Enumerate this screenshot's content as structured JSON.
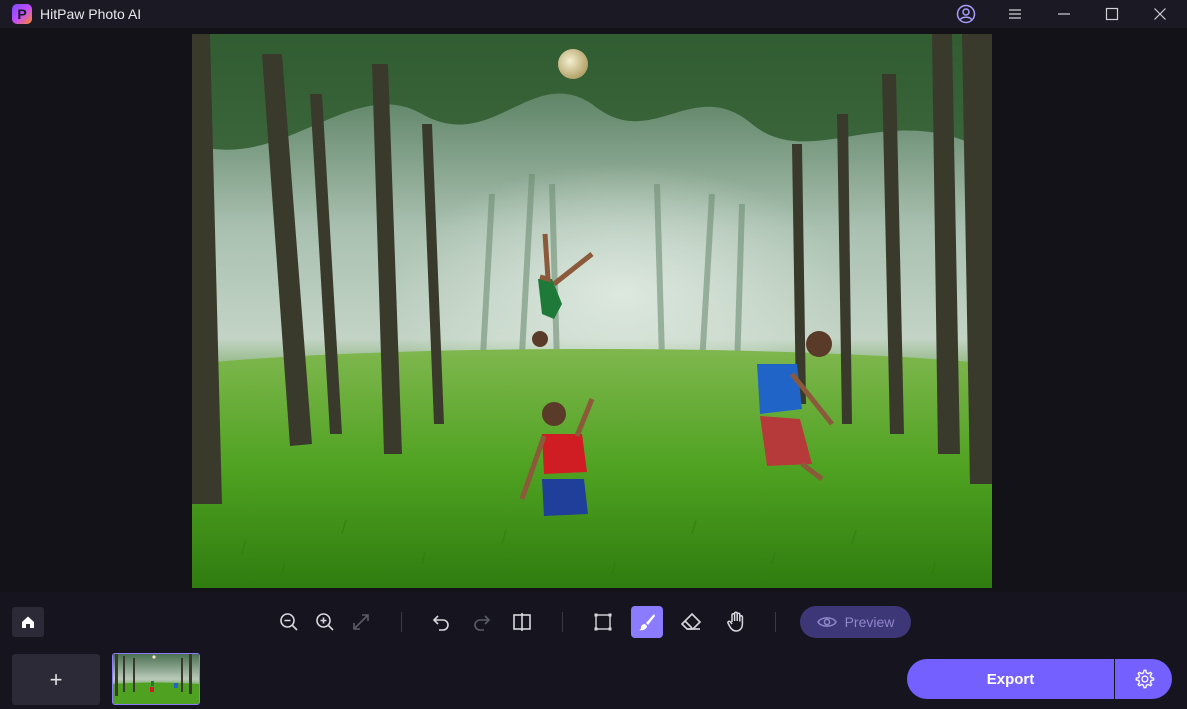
{
  "window": {
    "title": "HitPaw Photo AI",
    "logo_letter": "P",
    "icons": [
      "account-icon",
      "menu-icon",
      "minimize-icon",
      "maximize-icon",
      "close-icon"
    ]
  },
  "toolbar": {
    "tools": [
      "zoom-out",
      "zoom-in",
      "fit-screen",
      "undo",
      "redo",
      "compare",
      "rectangle-select",
      "brush",
      "eraser",
      "hand"
    ],
    "active_tool": "brush",
    "preview_label": "Preview"
  },
  "bottom": {
    "add_label": "+",
    "export_label": "Export"
  },
  "colors": {
    "accent": "#7460ff",
    "active_tool": "#8a7bff",
    "background": "#121218",
    "titlebar": "#1b1a24"
  }
}
